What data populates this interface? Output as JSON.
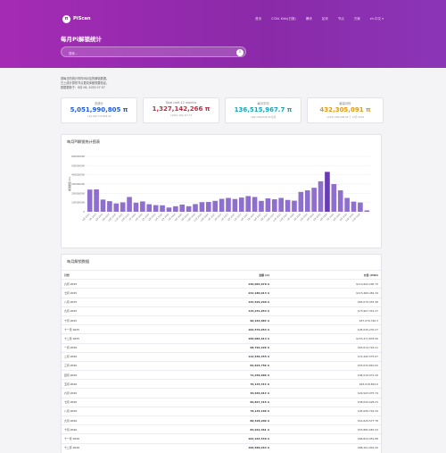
{
  "brand": {
    "name": "PiScan",
    "logo_glyph": "π"
  },
  "menu": [
    "首页",
    "CCNL Kids(日报)",
    "爆块",
    "区块",
    "节点",
    "方案",
    "zh-中文 ▾"
  ],
  "page": {
    "title": "每月Pi解锁统计"
  },
  "search": {
    "placeholder": "搜索..."
  },
  "notes": [
    "按每日的统计的时间对应的解锁数据。",
    "已上线计算的节点更具体都需要验证。",
    "数据更新于：6月 06, 2025 07:57"
  ],
  "cards": [
    {
      "label": "总统计",
      "value": "5,051,990,805 π",
      "sub": "≈$2,290,773,803.00",
      "color": "#1f5bd6"
    },
    {
      "label": "Total next 12 months",
      "value": "1,327,142,266 π",
      "sub": "≈$601,494,417.37",
      "color": "#d0243d"
    },
    {
      "label": "每月平均",
      "value": "136,515,967.7 π",
      "sub": "≈$61,580,045.00 每月",
      "color": "#16a6b8"
    },
    {
      "label": "最高月份",
      "value": "432,305,091 π",
      "sub": "≈$197,184,346.00 于 12月 2023",
      "color": "#e39a14"
    }
  ],
  "chart_panel": {
    "title": "每月Pi解锁统计图表"
  },
  "chart_data": {
    "type": "bar",
    "ylabel": "解锁数量 (Pi)",
    "ylim": [
      0,
      600000000
    ],
    "yticks": [
      "600000000",
      "500000000",
      "400000000",
      "300000000",
      "200000000",
      "100000000",
      "0"
    ],
    "categories": [
      "6月 2025",
      "7月 2025",
      "8月 2025",
      "9月 2025",
      "10月 2025",
      "11月 2025",
      "12月 2025",
      "1月 2026",
      "2月 2026",
      "3月 2026",
      "4月 2026",
      "5月 2026",
      "6月 2026",
      "7月 2026",
      "8月 2026",
      "9月 2026",
      "10月 2026",
      "11月 2026",
      "12月 2026",
      "1月 2027",
      "2月 2027",
      "3月 2027",
      "4月 2027",
      "5月 2027",
      "6月 2027",
      "7月 2027",
      "8月 2027",
      "9月 2027",
      "10月 2027",
      "11月 2027",
      "12月 2027",
      "1月 2028",
      "2月 2028",
      "3月 2028",
      "4月 2028",
      "5月 2028",
      "6月 2028",
      "7月 2028",
      "8月 2028",
      "9月 2028",
      "10月 2028",
      "11月 2028"
    ],
    "values": [
      240000000,
      242000000,
      132000000,
      115000000,
      90000000,
      102000000,
      160000000,
      98000000,
      112000000,
      82000000,
      72000000,
      70000000,
      46000000,
      60000000,
      78000000,
      60000000,
      83000000,
      104000000,
      106000000,
      118000000,
      140000000,
      150000000,
      138000000,
      154000000,
      170000000,
      160000000,
      118000000,
      145000000,
      135000000,
      150000000,
      128000000,
      120000000,
      215000000,
      232000000,
      260000000,
      330000000,
      432000000,
      300000000,
      232000000,
      150000000,
      110000000,
      100000000,
      15000000
    ],
    "bar_color": "#8f6fce",
    "bar_highlight": "#6b3ab5"
  },
  "table_panel": {
    "title": "每月解锁数据"
  },
  "table": {
    "headers": [
      "月份",
      "金额 (π)",
      "价值 (USD)"
    ],
    "rows": [
      [
        "六月 2025",
        "240,062,070 π",
        "$114,622,200.73"
      ],
      [
        "七月 2025",
        "242,180,013 π",
        "$115,460,482.34"
      ],
      [
        "八月 2025",
        "132,529,200 π",
        "$65,070,453.48"
      ],
      [
        "九月 2025",
        "115,231,954 π",
        "$73,967,314.27"
      ],
      [
        "十月 2025",
        "90,163,083 π",
        "$57,070,740.3"
      ],
      [
        "十一月 2025",
        "102,570,954 π",
        "$45,045,270.27"
      ],
      [
        "十二月 2025",
        "160,084,613 π",
        "$153,271,833.00"
      ],
      [
        "一月 2026",
        "98,792,229 π",
        "$63,614,716.21"
      ],
      [
        "二月 2026",
        "112,530,355 π",
        "$72,492,575.67"
      ],
      [
        "三月 2026",
        "82,624,759 π",
        "$53,034,810.02"
      ],
      [
        "四月 2026",
        "72,456,990 π",
        "$46,510,071.20"
      ],
      [
        "五月 2026",
        "70,133,414 π",
        "$45,018,824.0"
      ],
      [
        "六月 2026",
        "46,646,013 π",
        "$29,943,075.74"
      ],
      [
        "七月 2026",
        "60,827,415 π",
        "$38,050,028.23"
      ],
      [
        "八月 2026",
        "78,145,168 π",
        "$45,006,742.34"
      ],
      [
        "九月 2026",
        "80,428,200 π",
        "$51,625,577.78"
      ],
      [
        "十月 2026",
        "83,942,361 π",
        "$53,882,681.53"
      ],
      [
        "十一月 2026",
        "104,103,539 π",
        "$66,824,051.88"
      ],
      [
        "十二月 2026",
        "106,560,264 π",
        "$68,401,901.00"
      ]
    ]
  }
}
